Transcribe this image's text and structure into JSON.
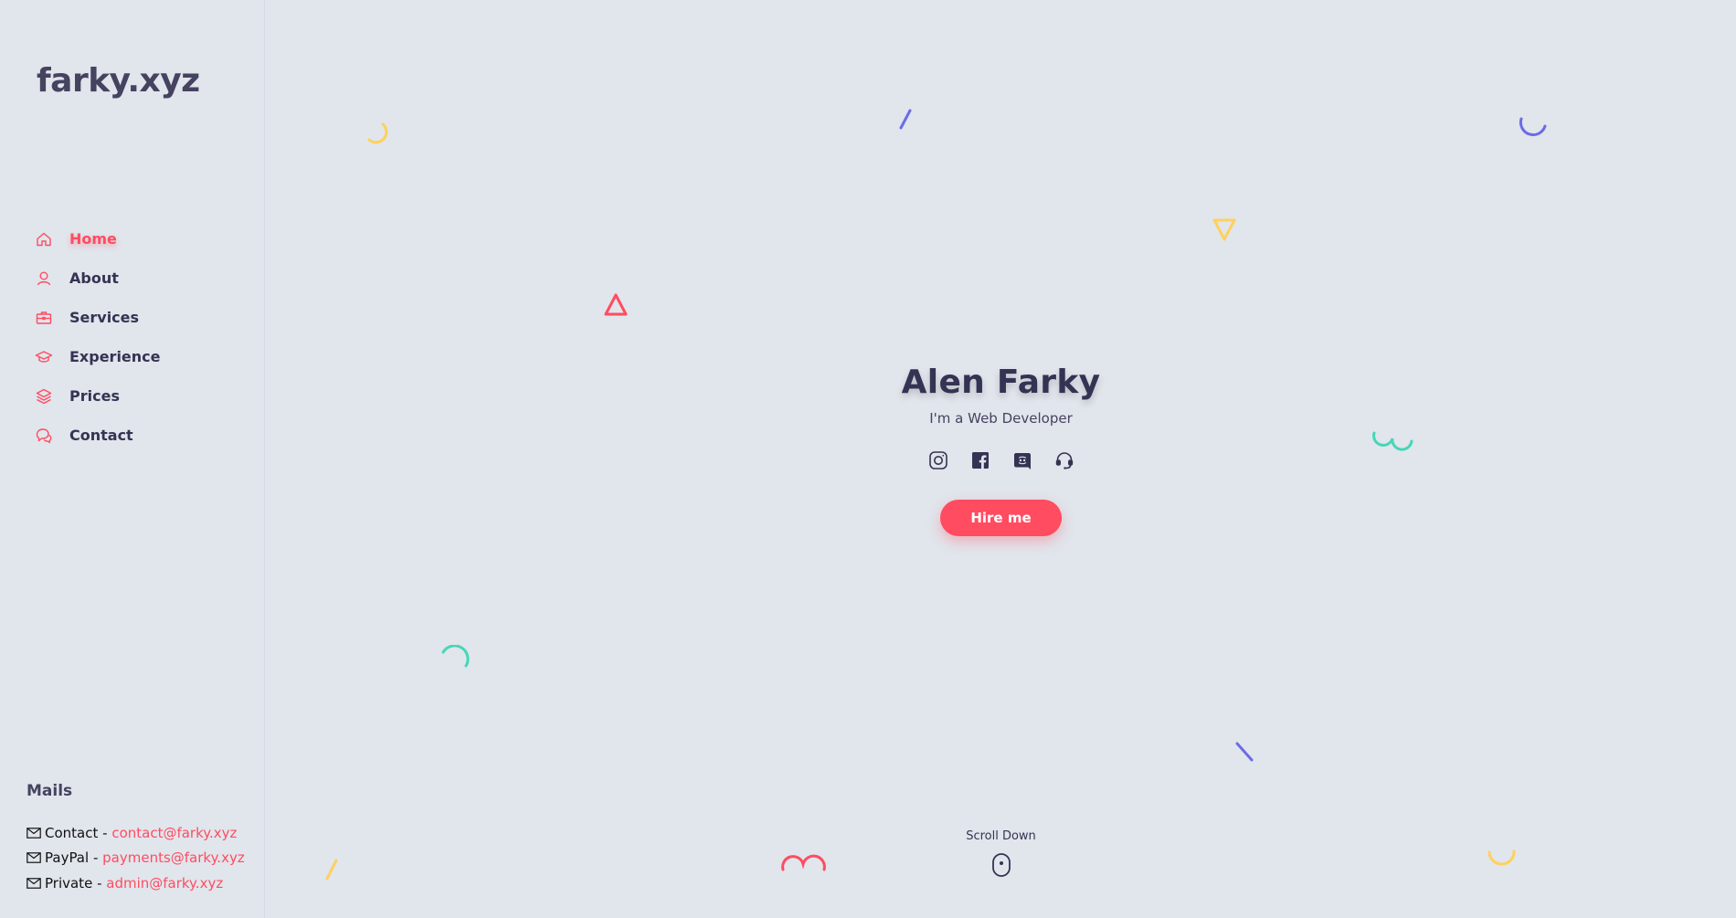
{
  "site": {
    "logo": "farky.xyz"
  },
  "sidebar": {
    "items": [
      {
        "label": "Home",
        "icon": "home-icon",
        "active": true
      },
      {
        "label": "About",
        "icon": "user-icon"
      },
      {
        "label": "Services",
        "icon": "briefcase-icon"
      },
      {
        "label": "Experience",
        "icon": "graduation-cap-icon"
      },
      {
        "label": "Prices",
        "icon": "layers-icon"
      },
      {
        "label": "Contact",
        "icon": "chat-icon"
      }
    ]
  },
  "mails": {
    "title": "Mails",
    "rows": [
      {
        "label": "Contact - ",
        "email": "contact@farky.xyz"
      },
      {
        "label": "PayPal - ",
        "email": "payments@farky.xyz"
      },
      {
        "label": "Private - ",
        "email": "admin@farky.xyz"
      }
    ]
  },
  "hero": {
    "name": "Alen Farky",
    "subtitle": "I'm a Web Developer",
    "socials": [
      "instagram-icon",
      "facebook-icon",
      "discord-icon",
      "support-headset-icon"
    ],
    "button_label": "Hire me"
  },
  "scroll": {
    "label": "Scroll Down"
  },
  "colors": {
    "accent": "#ff4c60",
    "background": "#e1e5ec",
    "text": "#353353",
    "yellow": "#ffd15c",
    "purple": "#6c6ce5",
    "green": "#44d7b6"
  }
}
